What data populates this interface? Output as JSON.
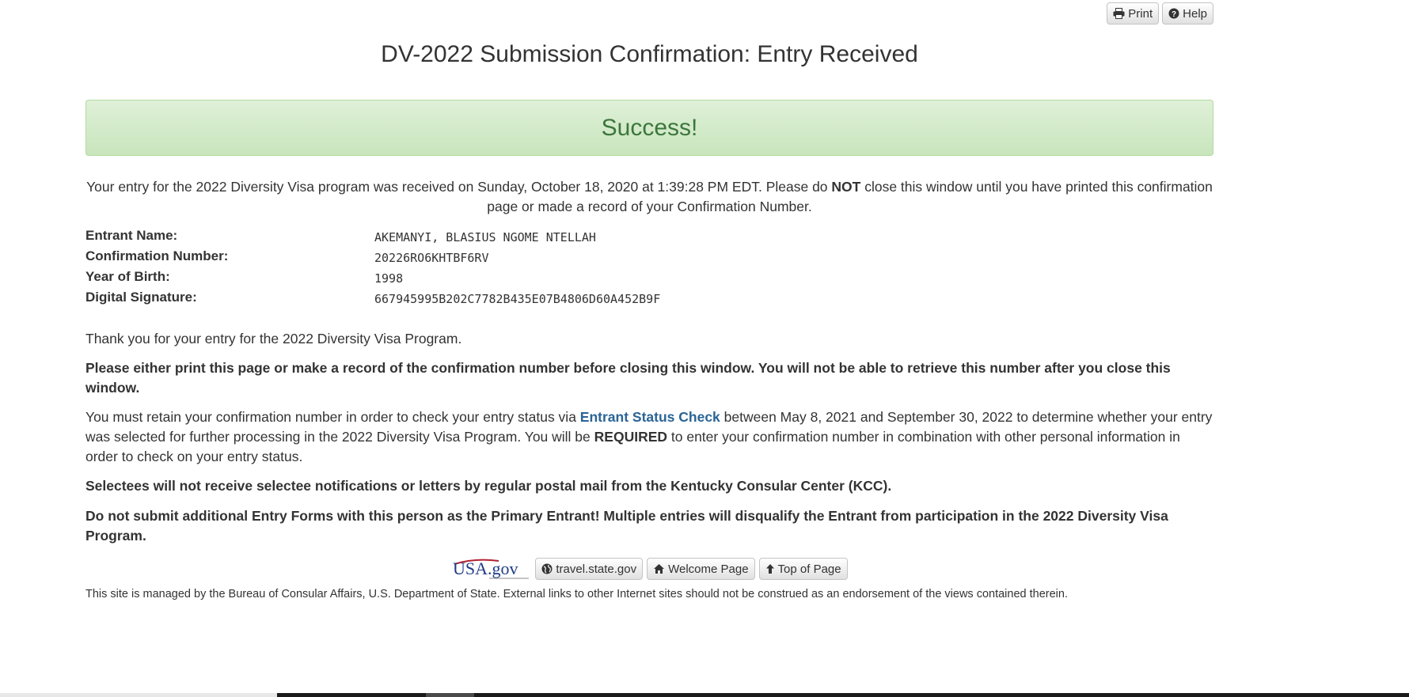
{
  "toolbar": {
    "print_label": "Print",
    "help_label": "Help"
  },
  "page_title": "DV-2022 Submission Confirmation: Entry Received",
  "alert_text": "Success!",
  "intro": {
    "part1": "Your entry for the 2022 Diversity Visa program was received on Sunday, October 18, 2020 at 1:39:28 PM EDT. Please do ",
    "emphasis": "NOT",
    "part2": " close this window until you have printed this confirmation page or made a record of your Confirmation Number."
  },
  "details": [
    {
      "label": "Entrant Name:",
      "value": "AKEMANYI, BLASIUS NGOME NTELLAH"
    },
    {
      "label": "Confirmation Number:",
      "value": "20226RO6KHTBF6RV"
    },
    {
      "label": "Year of Birth:",
      "value": "1998"
    },
    {
      "label": "Digital Signature:",
      "value": "667945995B202C7782B435E07B4806D60A452B9F"
    }
  ],
  "thank_you": "Thank you for your entry for the 2022 Diversity Visa Program.",
  "print_warning": "Please either print this page or make a record of the confirmation number before closing this window. You will not be able to retrieve this number after you close this window.",
  "retain": {
    "part1": "You must retain your confirmation number in order to check your entry status via ",
    "link": "Entrant Status Check",
    "part2": " between May 8, 2021 and September 30, 2022 to determine whether your entry was selected for further processing in the 2022 Diversity Visa Program. You will be ",
    "emphasis": "REQUIRED",
    "part3": " to enter your confirmation number in combination with other personal information in order to check on your entry status."
  },
  "selectees_notice": "Selectees will not receive selectee notifications or letters by regular postal mail from the Kentucky Consular Center (KCC).",
  "multiple_entries_warning": "Do not submit additional Entry Forms with this person as the Primary Entrant! Multiple entries will disqualify the Entrant from participation in the 2022 Diversity Visa Program.",
  "footer_links": {
    "logo_text": "USA.gov",
    "travel": "travel.state.gov",
    "welcome": "Welcome Page",
    "top": "Top of Page"
  },
  "footer_text": "This site is managed by the Bureau of Consular Affairs, U.S. Department of State. External links to other Internet sites should not be construed as an endorsement of the views contained therein.",
  "colors": {
    "success_text": "#3c763d",
    "success_bg": "#dff0d8",
    "link": "#2a6496",
    "text": "#333333"
  }
}
